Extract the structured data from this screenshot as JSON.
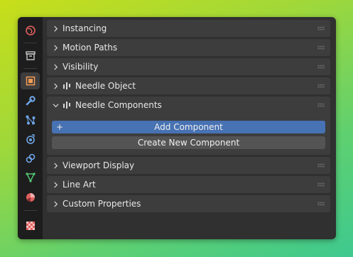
{
  "sidebar": {
    "tabs": [
      {
        "icon": "scene-globe-icon",
        "color": "#e0605e"
      },
      {
        "icon": "collection-box-icon",
        "color": "#c8c8c8"
      },
      {
        "icon": "object-properties-icon",
        "color": "#f29b53",
        "active": true
      },
      {
        "icon": "wrench-modifier-icon",
        "color": "#6fa6e8"
      },
      {
        "icon": "particles-icon",
        "color": "#6fa6e8"
      },
      {
        "icon": "physics-icon",
        "color": "#6fa6e8"
      },
      {
        "icon": "constraints-icon",
        "color": "#6fa6e8"
      },
      {
        "icon": "object-data-icon",
        "color": "#54c874"
      },
      {
        "icon": "material-icon",
        "color": "#e0605e"
      },
      {
        "icon": "texture-checker-icon",
        "color": "#e0605e"
      }
    ]
  },
  "panels": [
    {
      "label": "Instancing"
    },
    {
      "label": "Motion Paths"
    },
    {
      "label": "Visibility"
    },
    {
      "label": "Needle Object",
      "icon": "needle-icon"
    },
    {
      "label": "Needle Components",
      "icon": "needle-icon",
      "expanded": true
    },
    {
      "label": "Viewport Display"
    },
    {
      "label": "Line Art"
    },
    {
      "label": "Custom Properties"
    }
  ],
  "needle_components": {
    "add_button": "Add Component",
    "add_icon": "+",
    "create_button": "Create New Component"
  },
  "colors": {
    "accent_button": "#4772b3",
    "panel_bg": "#3d3d3d",
    "window_bg": "#303030"
  }
}
